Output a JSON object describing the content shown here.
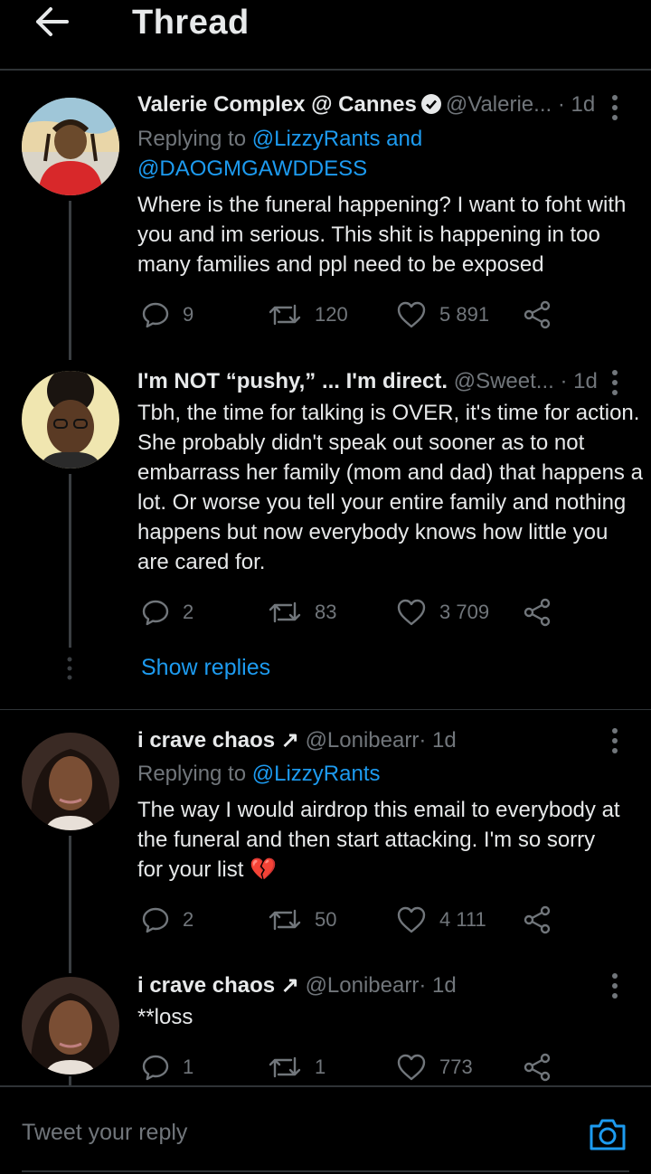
{
  "header": {
    "title": "Thread"
  },
  "tweets": [
    {
      "display_name": "Valerie Complex @ Cannes",
      "handle": "@Valerie...",
      "time": "· 1d",
      "reply_prefix": "Replying to",
      "reply_users": "@LizzyRants and @DAOGMGAWDDESS",
      "body": "Where is the funeral happening? I want to foht with you and im serious. This shit is happening in too many families and ppl need to be exposed",
      "replies": "9",
      "retweets": "120",
      "likes": "5 891"
    },
    {
      "display_name": "I'm NOT “pushy,” ... I'm direct.",
      "handle": "@Sweet...",
      "time": "· 1d",
      "body": "Tbh, the time for talking is OVER,  it's time for action. She probably didn't speak out sooner as to not embarrass her family (mom and dad) that happens a lot. Or worse you tell your entire family and nothing happens but now everybody knows how little you are cared for.",
      "replies": "2",
      "retweets": "83",
      "likes": "3 709"
    },
    {
      "display_name": "i crave chaos",
      "name_glyph": "↗",
      "handle": "@Lonibearr",
      "time": "· 1d",
      "reply_prefix": "Replying to",
      "reply_users": "@LizzyRants",
      "body": "The way I would airdrop this email to everybody at the funeral and then start attacking. I'm so sorry for your list",
      "emoji": "💔",
      "replies": "2",
      "retweets": "50",
      "likes": "4 111"
    },
    {
      "display_name": "i crave chaos",
      "name_glyph": "↗",
      "handle": "@Lonibearr",
      "time": "· 1d",
      "body": "**loss",
      "replies": "1",
      "retweets": "1",
      "likes": "773"
    }
  ],
  "show_replies": "Show replies",
  "reply_bar": {
    "placeholder": "Tweet your reply"
  },
  "colors": {
    "background": "#000000",
    "accent": "#1d9bf0",
    "muted": "#71767b",
    "text": "#e7e9ea"
  }
}
